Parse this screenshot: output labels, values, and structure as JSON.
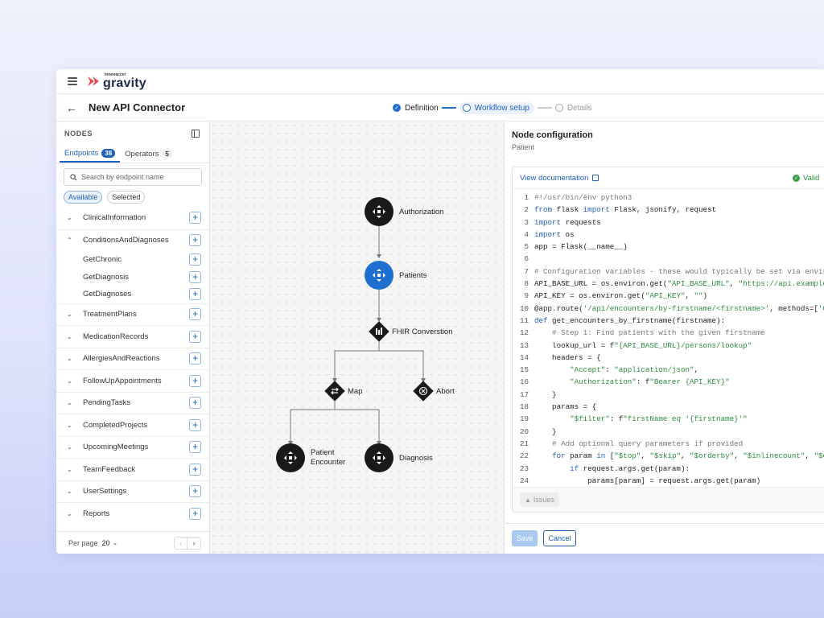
{
  "brand": {
    "small": "innovaccer",
    "name": "gravity"
  },
  "header": {
    "title": "New API Connector"
  },
  "stepper": [
    {
      "label": "Definition",
      "state": "done"
    },
    {
      "label": "Workflow setup",
      "state": "active"
    },
    {
      "label": "Details",
      "state": "idle"
    }
  ],
  "sidebar": {
    "title": "NODES",
    "tabs": [
      {
        "label": "Endpoints",
        "count": "38"
      },
      {
        "label": "Operators",
        "count": "5"
      }
    ],
    "search_placeholder": "Search by endpoint name",
    "chips": [
      "Available",
      "Selected"
    ],
    "groups": [
      {
        "label": "ClinicalInformation",
        "expanded": false
      },
      {
        "label": "ConditionsAndDiagnoses",
        "expanded": true,
        "children": [
          "GetChronic",
          "GetDiagnosis",
          "GetDiagnoses"
        ]
      },
      {
        "label": "TreatmentPlans",
        "expanded": false
      },
      {
        "label": "MedicationRecords",
        "expanded": false
      },
      {
        "label": "AllergiesAndReactions",
        "expanded": false
      },
      {
        "label": "FollowUpAppointments",
        "expanded": false
      },
      {
        "label": "PendingTasks",
        "expanded": false
      },
      {
        "label": "CompletedProjects",
        "expanded": false
      },
      {
        "label": "UpcomingMeetings",
        "expanded": false
      },
      {
        "label": "TeamFeedback",
        "expanded": false
      },
      {
        "label": "UserSettings",
        "expanded": false
      },
      {
        "label": "Reports",
        "expanded": false
      }
    ],
    "footer": {
      "per_page_label": "Per page",
      "per_page_value": "20"
    }
  },
  "flow": {
    "nodes": {
      "authorization": "Authorization",
      "patients": "Patients",
      "fhir": "FHIR Converstion",
      "map": "Map",
      "abort": "Abort",
      "patient_encounter": "Patient Encounter",
      "diagnosis": "Diagnosis"
    },
    "selected_color": "#1f6fd0",
    "node_color": "#1a1a1a"
  },
  "config": {
    "title": "Node configuration",
    "subtitle": "Patient",
    "doc_link": "View documentation",
    "status": "Valid",
    "issues_label": "Issues",
    "save_label": "Save",
    "cancel_label": "Cancel",
    "code": [
      "#!/usr/bin/env python3",
      "from flask import Flask, jsonify, request",
      "import requests",
      "import os",
      "app = Flask(__name__)",
      "",
      "# Configuration variables - these would typically be set via envir",
      "API_BASE_URL = os.environ.get(\"API_BASE_URL\", \"https://api.example",
      "API_KEY = os.environ.get(\"API_KEY\", \"\")",
      "@app.route('/api/encounters/by-firstname/<firstname>', methods=['G",
      "def get_encounters_by_firstname(firstname):",
      "    # Step 1: Find patients with the given firstname",
      "    lookup_url = f\"{API_BASE_URL}/persons/lookup\"",
      "    headers = {",
      "        \"Accept\": \"application/json\",",
      "        \"Authorization\": f\"Bearer {API_KEY}\"",
      "    }",
      "    params = {",
      "        \"$filter\": f\"firstName eq '{firstname}'\"",
      "    }",
      "    # Add optional query parameters if provided",
      "    for param in [\"$top\", \"$skip\", \"$orderby\", \"$inlinecount\", \"$c",
      "        if request.args.get(param):",
      "            params[param] = request.args.get(param)"
    ]
  }
}
